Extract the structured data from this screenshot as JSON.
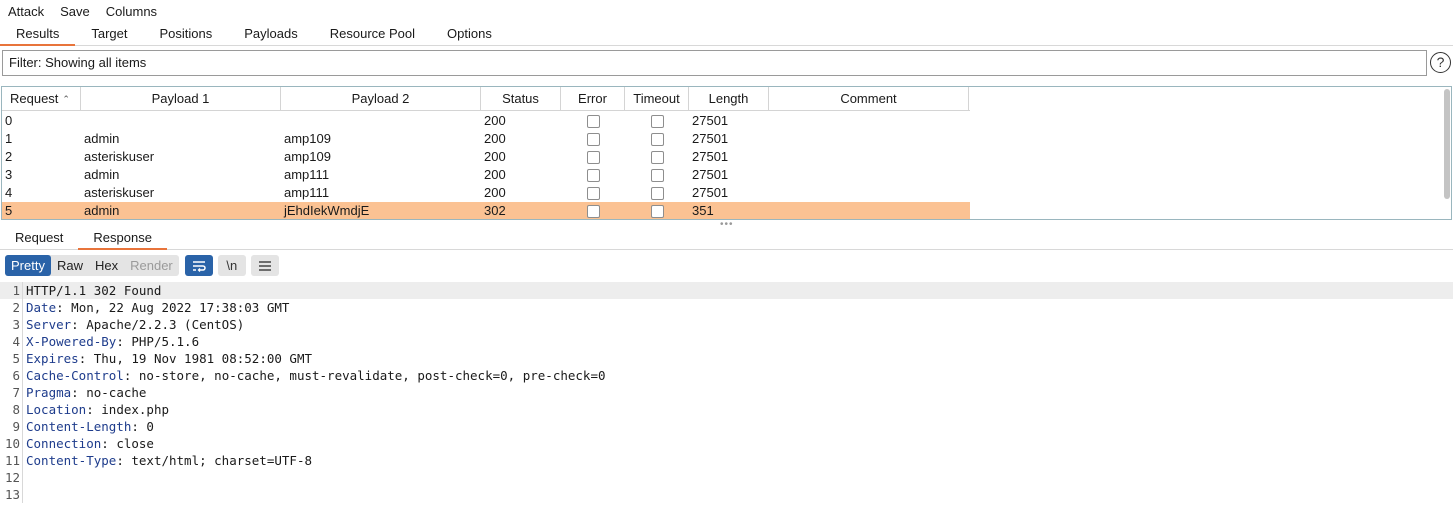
{
  "menu": {
    "items": [
      "Attack",
      "Save",
      "Columns"
    ]
  },
  "main_tabs": [
    {
      "label": "Results",
      "active": true
    },
    {
      "label": "Target",
      "active": false
    },
    {
      "label": "Positions",
      "active": false
    },
    {
      "label": "Payloads",
      "active": false
    },
    {
      "label": "Resource Pool",
      "active": false
    },
    {
      "label": "Options",
      "active": false
    }
  ],
  "filter": {
    "text": "Filter: Showing all items",
    "help_icon": "question-circle-icon"
  },
  "table": {
    "columns": [
      "Request",
      "Payload 1",
      "Payload 2",
      "Status",
      "Error",
      "Timeout",
      "Length",
      "Comment"
    ],
    "sort_icon": "sort-ascending-chevron",
    "rows": [
      {
        "request": "0",
        "payload1": "",
        "payload2": "",
        "status": "200",
        "error": false,
        "timeout": false,
        "length": "27501",
        "comment": ""
      },
      {
        "request": "1",
        "payload1": "admin",
        "payload2": "amp109",
        "status": "200",
        "error": false,
        "timeout": false,
        "length": "27501",
        "comment": ""
      },
      {
        "request": "2",
        "payload1": "asteriskuser",
        "payload2": "amp109",
        "status": "200",
        "error": false,
        "timeout": false,
        "length": "27501",
        "comment": ""
      },
      {
        "request": "3",
        "payload1": "admin",
        "payload2": "amp111",
        "status": "200",
        "error": false,
        "timeout": false,
        "length": "27501",
        "comment": ""
      },
      {
        "request": "4",
        "payload1": "asteriskuser",
        "payload2": "amp111",
        "status": "200",
        "error": false,
        "timeout": false,
        "length": "27501",
        "comment": ""
      },
      {
        "request": "5",
        "payload1": "admin",
        "payload2": "jEhdIekWmdjE",
        "status": "302",
        "error": false,
        "timeout": false,
        "length": "351",
        "comment": "",
        "selected": true
      }
    ],
    "selected_color": "#fbc293"
  },
  "lower_tabs": [
    {
      "label": "Request",
      "active": false
    },
    {
      "label": "Response",
      "active": true
    }
  ],
  "editor": {
    "view_modes": [
      {
        "label": "Pretty",
        "active": true
      },
      {
        "label": "Raw",
        "active": false
      },
      {
        "label": "Hex",
        "active": false
      },
      {
        "label": "Render",
        "active": false,
        "disabled": true
      }
    ],
    "wrap_icon": "word-wrap-icon",
    "newline_label": "\\n",
    "menu_icon": "hamburger-menu-icon",
    "accent": "#2a63a8",
    "lines": [
      {
        "n": "1",
        "key": "",
        "value": "HTTP/1.1 302 Found"
      },
      {
        "n": "2",
        "key": "Date",
        "value": "Mon, 22 Aug 2022 17:38:03 GMT"
      },
      {
        "n": "3",
        "key": "Server",
        "value": "Apache/2.2.3 (CentOS)"
      },
      {
        "n": "4",
        "key": "X-Powered-By",
        "value": "PHP/5.1.6"
      },
      {
        "n": "5",
        "key": "Expires",
        "value": "Thu, 19 Nov 1981 08:52:00 GMT"
      },
      {
        "n": "6",
        "key": "Cache-Control",
        "value": "no-store, no-cache, must-revalidate, post-check=0, pre-check=0"
      },
      {
        "n": "7",
        "key": "Pragma",
        "value": "no-cache"
      },
      {
        "n": "8",
        "key": "Location",
        "value": "index.php"
      },
      {
        "n": "9",
        "key": "Content-Length",
        "value": "0"
      },
      {
        "n": "10",
        "key": "Connection",
        "value": "close"
      },
      {
        "n": "11",
        "key": "Content-Type",
        "value": "text/html; charset=UTF-8"
      },
      {
        "n": "12",
        "key": "",
        "value": ""
      },
      {
        "n": "13",
        "key": "",
        "value": ""
      }
    ]
  }
}
